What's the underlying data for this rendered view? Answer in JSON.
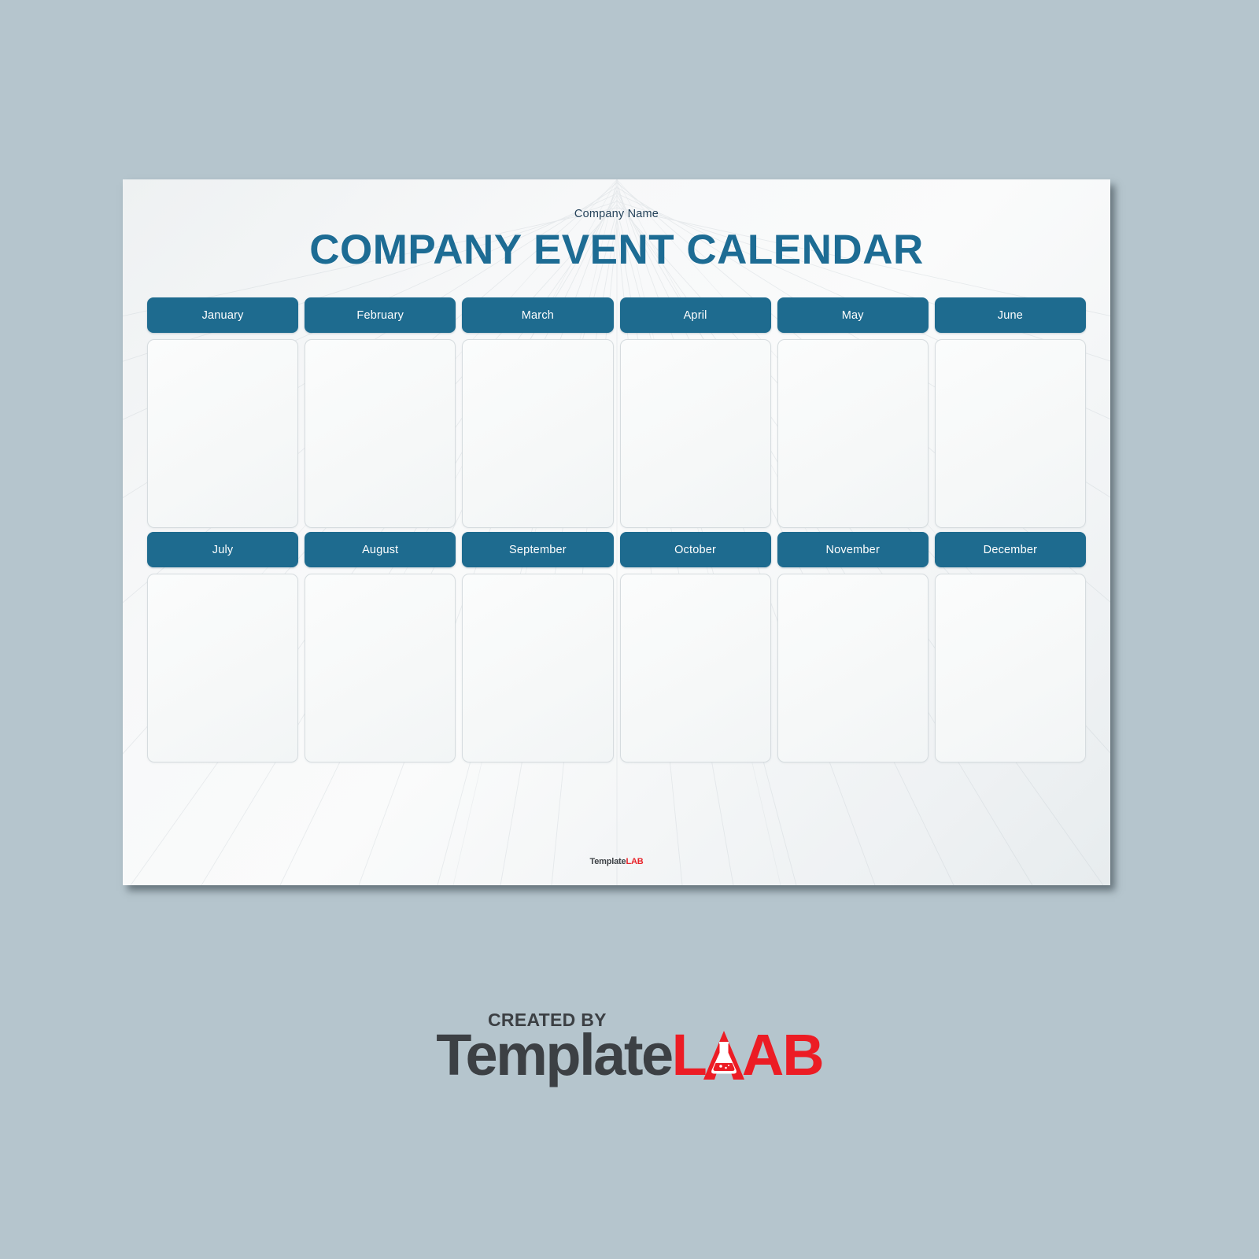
{
  "page": {
    "company_name": "Company Name",
    "title": "COMPANY EVENT CALENDAR",
    "footer_logo": {
      "template": "Template",
      "lab": "LAB"
    }
  },
  "calendar": {
    "rows": [
      {
        "months": [
          {
            "label": "January"
          },
          {
            "label": "February"
          },
          {
            "label": "March"
          },
          {
            "label": "April"
          },
          {
            "label": "May"
          },
          {
            "label": "June"
          }
        ]
      },
      {
        "months": [
          {
            "label": "July"
          },
          {
            "label": "August"
          },
          {
            "label": "September"
          },
          {
            "label": "October"
          },
          {
            "label": "November"
          },
          {
            "label": "December"
          }
        ]
      }
    ]
  },
  "branding": {
    "created_by": "CREATED BY",
    "template": "Template",
    "l": "L",
    "a": "A",
    "b": "AB",
    "flask_icon": "flask-icon"
  },
  "colors": {
    "background": "#b5c5cd",
    "paper": "#f4f6f7",
    "accent_teal": "#1e6b8f",
    "title_blue": "#1d6c94",
    "company_name_text": "#24425a",
    "logo_dark": "#3c4044",
    "logo_red": "#ec1c24",
    "cell_border": "#d6dcdf"
  }
}
